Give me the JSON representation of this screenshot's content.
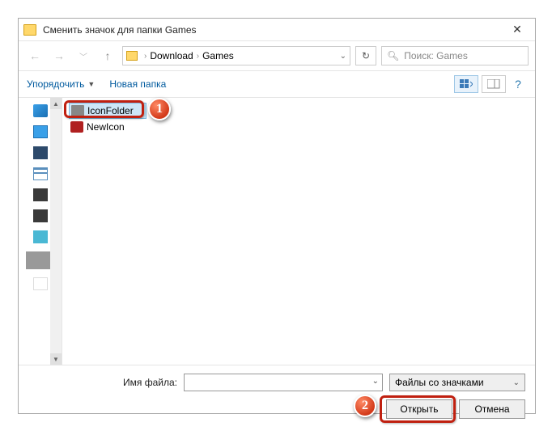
{
  "window": {
    "title": "Сменить значок для папки Games"
  },
  "nav": {
    "path_parts": [
      "Download",
      "Games"
    ],
    "search_placeholder": "Поиск: Games"
  },
  "toolbar": {
    "organize": "Упорядочить",
    "new_folder": "Новая папка"
  },
  "files": [
    {
      "name": "IconFolder",
      "icon": "folder-icon",
      "selected": true
    },
    {
      "name": "NewIcon",
      "icon": "program-icon",
      "selected": false
    }
  ],
  "footer": {
    "filename_label": "Имя файла:",
    "filename_value": "",
    "filter": "Файлы со значками",
    "open": "Открыть",
    "cancel": "Отмена"
  },
  "callouts": {
    "one": "1",
    "two": "2"
  }
}
